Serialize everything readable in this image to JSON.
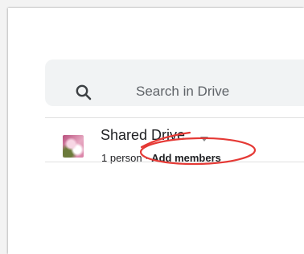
{
  "search": {
    "placeholder": "Search in Drive",
    "icon": "search-icon"
  },
  "drive": {
    "name": "Shared Drive",
    "member_count": "1 person",
    "separator": "·",
    "add_members_label": "Add members"
  },
  "annotation": {
    "color": "#e53935"
  }
}
